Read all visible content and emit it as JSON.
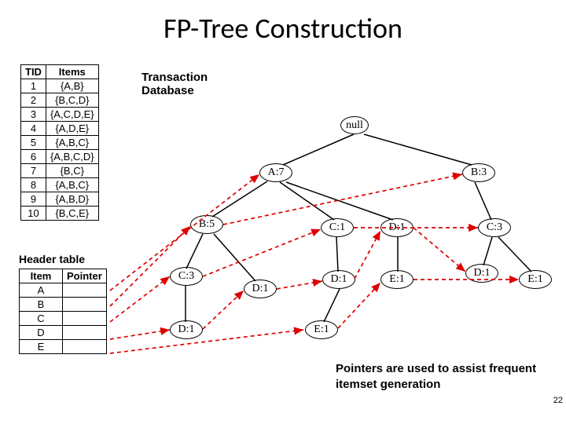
{
  "title": "FP-Tree Construction",
  "txn_caption": "Transaction\nDatabase",
  "txn_table": {
    "headers": [
      "TID",
      "Items"
    ],
    "rows": [
      [
        "1",
        "{A,B}"
      ],
      [
        "2",
        "{B,C,D}"
      ],
      [
        "3",
        "{A,C,D,E}"
      ],
      [
        "4",
        "{A,D,E}"
      ],
      [
        "5",
        "{A,B,C}"
      ],
      [
        "6",
        "{A,B,C,D}"
      ],
      [
        "7",
        "{B,C}"
      ],
      [
        "8",
        "{A,B,C}"
      ],
      [
        "9",
        "{A,B,D}"
      ],
      [
        "10",
        "{B,C,E}"
      ]
    ]
  },
  "header_table_caption": "Header table",
  "header_table": {
    "headers": [
      "Item",
      "Pointer"
    ],
    "rows": [
      "A",
      "B",
      "C",
      "D",
      "E"
    ]
  },
  "note_text": "Pointers are used to assist frequent itemset generation",
  "slide_number": "22",
  "tree_nodes": {
    "null": "null",
    "a7": "A:7",
    "b3": "B:3",
    "b5": "B:5",
    "c1a": "C:1",
    "d1a": "D:1",
    "c3b": "C:3",
    "c3a": "C:3",
    "d1b": "D:1",
    "e1a": "E:1",
    "d1c": "D:1",
    "e1c": "E:1",
    "d1d": "D:1",
    "d1e": "D:1",
    "e1b": "E:1"
  },
  "chart_data": {
    "type": "diagram",
    "description": "FP-tree with linked item header table",
    "transactions": [
      {
        "tid": 1,
        "items": [
          "A",
          "B"
        ]
      },
      {
        "tid": 2,
        "items": [
          "B",
          "C",
          "D"
        ]
      },
      {
        "tid": 3,
        "items": [
          "A",
          "C",
          "D",
          "E"
        ]
      },
      {
        "tid": 4,
        "items": [
          "A",
          "D",
          "E"
        ]
      },
      {
        "tid": 5,
        "items": [
          "A",
          "B",
          "C"
        ]
      },
      {
        "tid": 6,
        "items": [
          "A",
          "B",
          "C",
          "D"
        ]
      },
      {
        "tid": 7,
        "items": [
          "B",
          "C"
        ]
      },
      {
        "tid": 8,
        "items": [
          "A",
          "B",
          "C"
        ]
      },
      {
        "tid": 9,
        "items": [
          "A",
          "B",
          "D"
        ]
      },
      {
        "tid": 10,
        "items": [
          "B",
          "C",
          "E"
        ]
      }
    ],
    "header_items": [
      "A",
      "B",
      "C",
      "D",
      "E"
    ],
    "nodes": [
      {
        "id": "null",
        "label": "null",
        "parent": null
      },
      {
        "id": "A7",
        "label": "A:7",
        "parent": "null"
      },
      {
        "id": "B3",
        "label": "B:3",
        "parent": "null"
      },
      {
        "id": "B5",
        "label": "B:5",
        "parent": "A7"
      },
      {
        "id": "C1_A",
        "label": "C:1",
        "parent": "A7"
      },
      {
        "id": "D1_A",
        "label": "D:1",
        "parent": "A7"
      },
      {
        "id": "C3_B3",
        "label": "C:3",
        "parent": "B3"
      },
      {
        "id": "C3_B5",
        "label": "C:3",
        "parent": "B5"
      },
      {
        "id": "D1_B5",
        "label": "D:1",
        "parent": "B5"
      },
      {
        "id": "D1_C1A",
        "label": "D:1",
        "parent": "C1_A"
      },
      {
        "id": "E1_D1A",
        "label": "E:1",
        "parent": "D1_A"
      },
      {
        "id": "D1_C3B3",
        "label": "D:1",
        "parent": "C3_B3"
      },
      {
        "id": "E1_C3B3",
        "label": "E:1",
        "parent": "C3_B3"
      },
      {
        "id": "D1_C3B5",
        "label": "D:1",
        "parent": "C3_B5"
      },
      {
        "id": "E1_D1C1A",
        "label": "E:1",
        "parent": "D1_C1A"
      }
    ],
    "header_pointer_chains": {
      "A": [
        "A7"
      ],
      "B": [
        "B5",
        "B3"
      ],
      "C": [
        "C3_B5",
        "C1_A",
        "C3_B3"
      ],
      "D": [
        "D1_C3B5",
        "D1_B5",
        "D1_C1A",
        "D1_A",
        "D1_C3B3"
      ],
      "E": [
        "E1_D1C1A",
        "E1_D1A",
        "E1_C3B3"
      ]
    }
  }
}
